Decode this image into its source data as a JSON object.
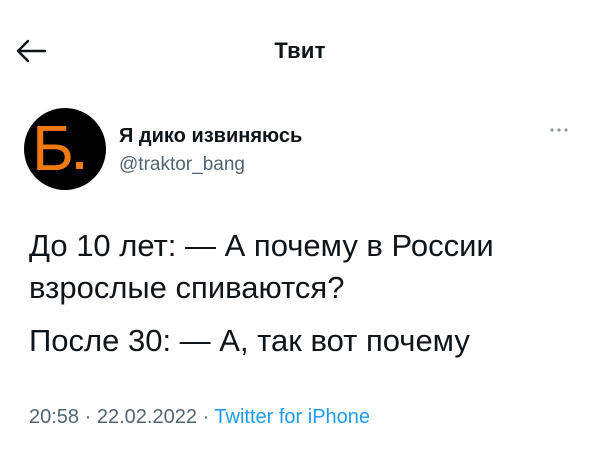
{
  "header": {
    "title": "Твит",
    "back_icon": "arrow-left-icon"
  },
  "author": {
    "avatar_letter": "Б",
    "avatar_colors": {
      "background": "#000000",
      "letter": "#f07a10"
    },
    "display_name": "Я дико извиняюсь",
    "handle": "@traktor_bang",
    "more_icon": "more-horizontal-icon"
  },
  "tweet": {
    "lines": [
      "До 10 лет: — А почему в России взрослые спиваются?",
      "После 30: — А, так вот почему"
    ]
  },
  "meta": {
    "time": "20:58",
    "separator": "·",
    "date": "22.02.2022",
    "source": "Twitter for iPhone",
    "source_color": "#1d9bf0"
  }
}
